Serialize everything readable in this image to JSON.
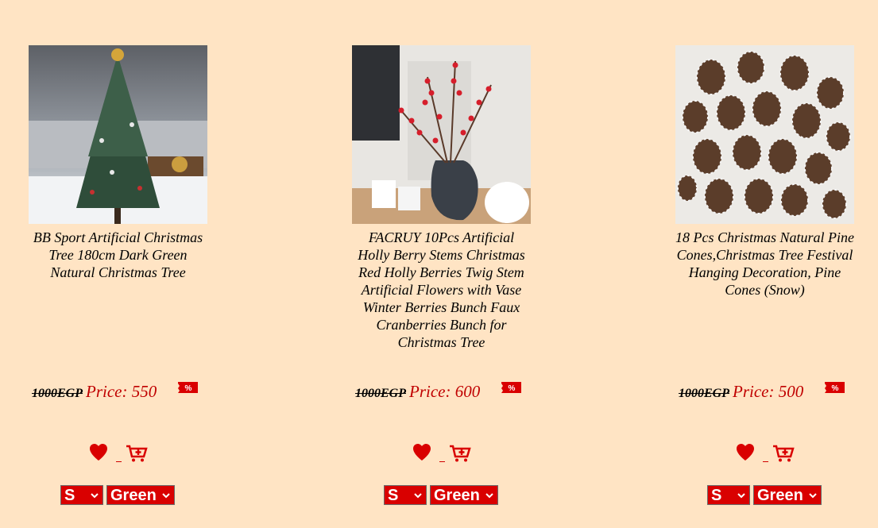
{
  "products": [
    {
      "title": "BB Sport Artificial Christmas Tree 180cm Dark Green Natural Christmas Tree",
      "old_price": "1000EGP",
      "price": "Price: 550",
      "size": "S",
      "color": "Green",
      "image": "christmas-tree-image"
    },
    {
      "title": "FACRUY 10Pcs Artificial Holly Berry Stems Christmas Red Holly Berries Twig Stem Artificial Flowers with Vase Winter Berries Bunch Faux Cranberries Bunch for Christmas Tree",
      "old_price": "1000EGP",
      "price": "Price: 600",
      "size": "S",
      "color": "Green",
      "image": "holly-berry-vase-image"
    },
    {
      "title": "18 Pcs Christmas Natural Pine Cones,Christmas Tree Festival Hanging Decoration, Pine Cones (Snow)",
      "old_price": "1000EGP",
      "price": "Price: 500",
      "size": "S",
      "color": "Green",
      "image": "pine-cones-image"
    }
  ],
  "icons": {
    "favorite": "heart-icon",
    "cart": "add-to-cart-icon",
    "discount": "discount-tag-icon",
    "dropdown": "chevron-down-icon"
  },
  "colors": {
    "background": "#ffe4c4",
    "accent": "#d90000",
    "price": "#c00000"
  }
}
